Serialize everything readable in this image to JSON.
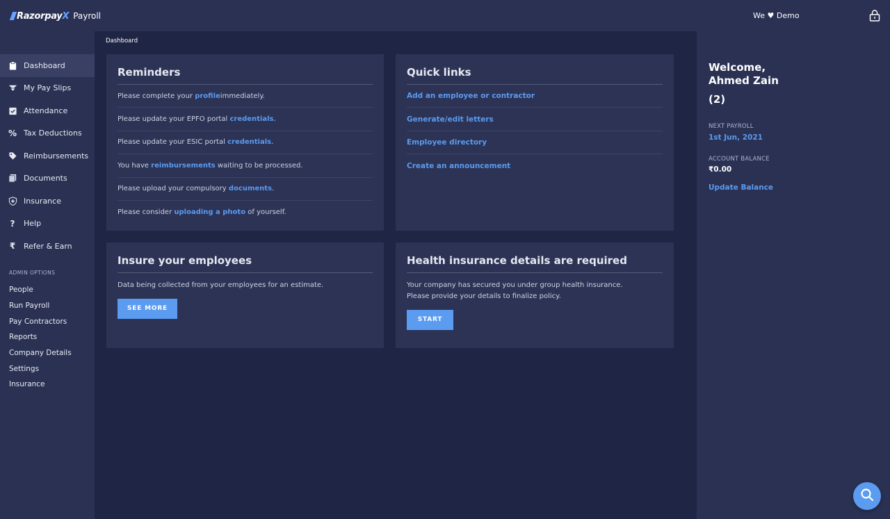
{
  "header": {
    "logo_brand": "Razorpay",
    "logo_x": "X",
    "product": "Payroll",
    "demo_prefix": "We",
    "demo_suffix": "Demo",
    "lock_icon": "lock-icon"
  },
  "sidebar": {
    "items": [
      {
        "label": "Dashboard",
        "icon": "clipboard-icon",
        "active": true
      },
      {
        "label": "My Pay Slips",
        "icon": "payslip-icon"
      },
      {
        "label": "Attendance",
        "icon": "calendar-check-icon"
      },
      {
        "label": "Tax Deductions",
        "icon": "percent-icon"
      },
      {
        "label": "Reimbursements",
        "icon": "tag-icon"
      },
      {
        "label": "Documents",
        "icon": "documents-icon"
      },
      {
        "label": "Insurance",
        "icon": "shield-plus-icon"
      },
      {
        "label": "Help",
        "icon": "question-icon"
      },
      {
        "label": "Refer & Earn",
        "icon": "rupee-icon"
      }
    ],
    "admin_heading": "ADMIN OPTIONS",
    "admin_items": [
      "People",
      "Run Payroll",
      "Pay Contractors",
      "Reports",
      "Company Details",
      "Settings",
      "Insurance"
    ]
  },
  "breadcrumb": "Dashboard",
  "reminders": {
    "title": "Reminders",
    "items": [
      {
        "pre": "Please complete your ",
        "link": "profile",
        "post": " immediately."
      },
      {
        "pre": "Please update your EPFO portal ",
        "link": "credentials",
        "post": "."
      },
      {
        "pre": "Please update your ESIC portal ",
        "link": "credentials",
        "post": "."
      },
      {
        "pre": "You have ",
        "link": "reimbursements",
        "post": " waiting to be processed."
      },
      {
        "pre": "Please upload your compulsory ",
        "link": "documents",
        "post": "."
      },
      {
        "pre": "Please consider ",
        "link": "uploading a photo",
        "post": " of yourself."
      }
    ]
  },
  "quick_links": {
    "title": "Quick links",
    "items": [
      "Add an employee or contractor",
      "Generate/edit letters",
      "Employee directory",
      "Create an announcement"
    ]
  },
  "insure": {
    "title": "Insure your employees",
    "text": "Data being collected from your employees for an estimate.",
    "button": "SEE MORE"
  },
  "health": {
    "title": "Health insurance details are required",
    "line1": "Your company has secured you under group health insurance.",
    "line2": "Please provide your details to finalize policy.",
    "button": "START"
  },
  "right_panel": {
    "welcome_line1": "Welcome,",
    "welcome_line2": "Ahmed Zain",
    "count": "(2)",
    "next_payroll_label": "NEXT PAYROLL",
    "next_payroll_value": "1st Jun, 2021",
    "account_balance_label": "ACCOUNT BALANCE",
    "account_balance_value": "₹0.00",
    "update_balance": "Update Balance"
  },
  "colors": {
    "accent": "#5b9bf0",
    "background": "#1f2544",
    "panel": "#2a3153",
    "card": "#2c3355"
  }
}
